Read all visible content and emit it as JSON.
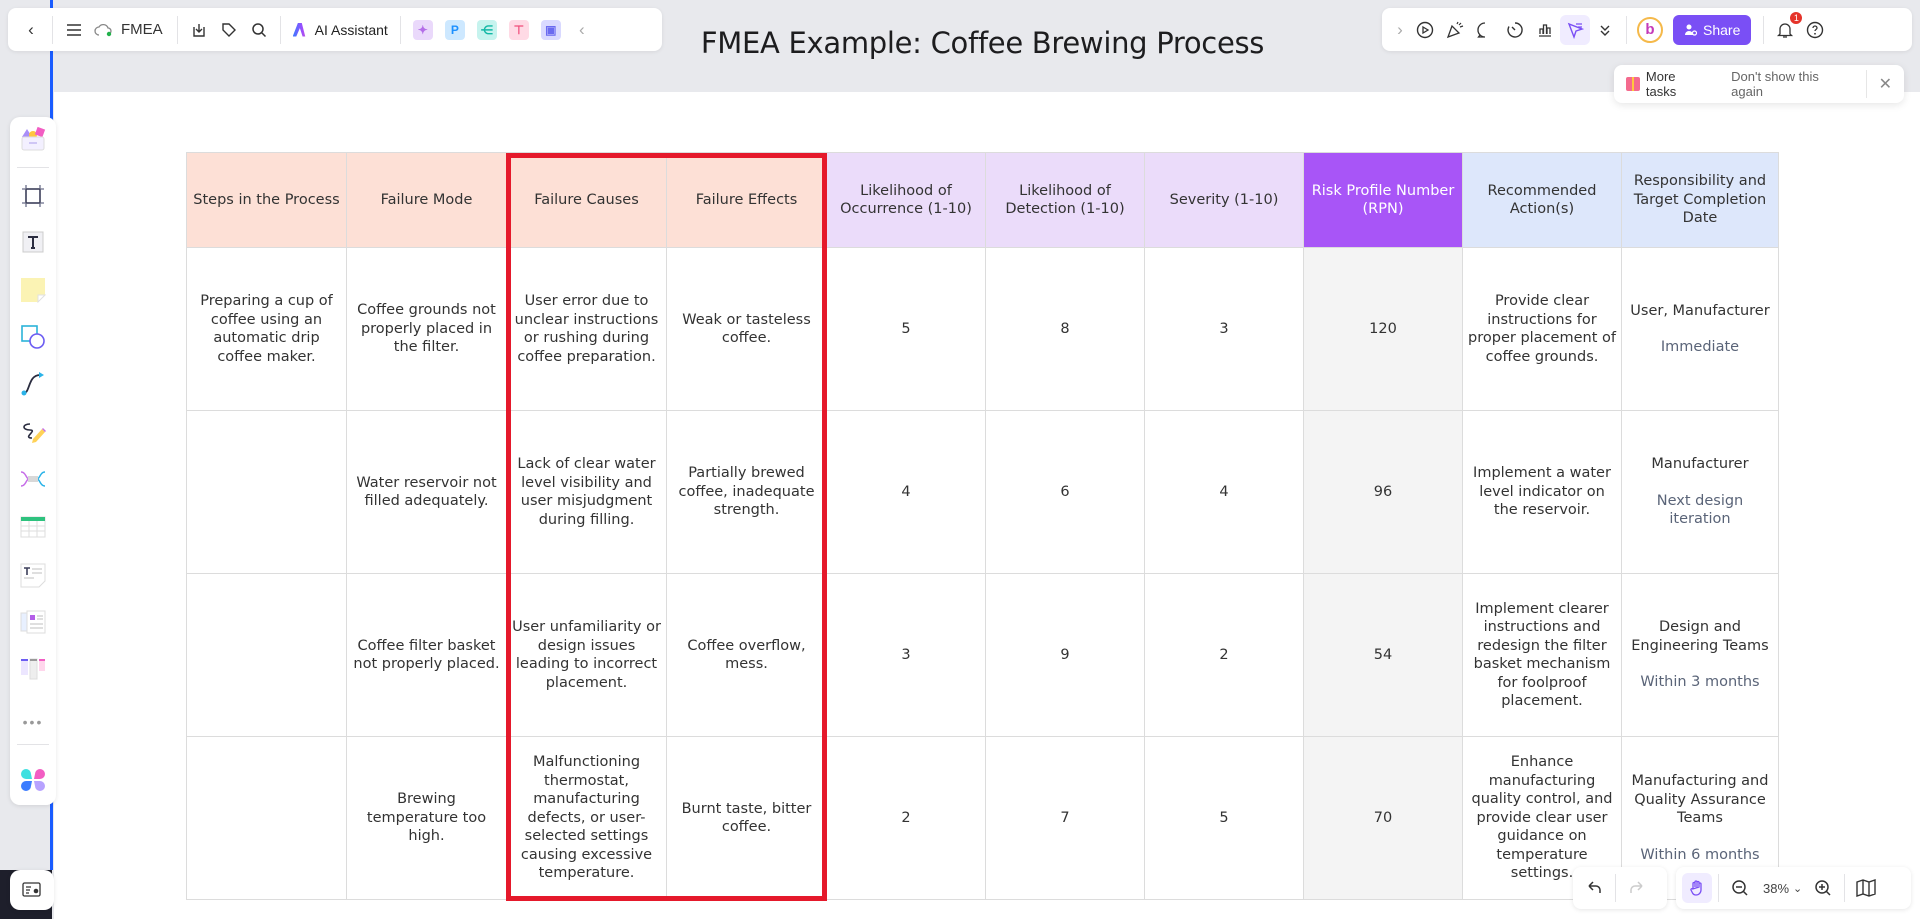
{
  "document": {
    "title": "FMEA Example: Coffee Brewing Process",
    "file_name": "FMEA"
  },
  "toolbar_left": {
    "back_icon": "chevron-left-icon",
    "menu_icon": "hamburger-menu-icon",
    "cloud_icon": "cloud-saved-icon",
    "file_name": "FMEA",
    "download_icon": "download-icon",
    "tag_icon": "tag-icon",
    "search_icon": "search-icon",
    "ai_assistant_label": "AI Assistant",
    "apps": [
      {
        "name": "image-gen-app",
        "color": "#e9d5ff",
        "glyph": "✦"
      },
      {
        "name": "presentation-app",
        "color": "#cfe8ff",
        "glyph": "P"
      },
      {
        "name": "mindmap-app",
        "color": "#c9f4ef",
        "glyph": "⋲"
      },
      {
        "name": "flowchart-app",
        "color": "#ffdbe6",
        "glyph": "⊤"
      },
      {
        "name": "chat-app",
        "color": "#dcdcff",
        "glyph": "▣"
      }
    ],
    "collapse_icon": "chevron-left-icon"
  },
  "toolbar_right": {
    "expand_icon": "chevron-right-icon",
    "tools": [
      "present-icon",
      "celebrate-icon",
      "comment-icon",
      "timer-icon",
      "vote-icon",
      "laser-pointer-icon",
      "more-tools-icon"
    ],
    "avatar_letter": "b",
    "share_label": "Share",
    "notification_count": "1",
    "help_icon": "help-icon"
  },
  "popup": {
    "more_tasks_label": "More tasks",
    "dont_show_label": "Don't show this again"
  },
  "palette": {
    "items": [
      "templates-icon",
      "frame-icon",
      "text-icon",
      "sticky-note-icon",
      "shape-icon",
      "connector-icon",
      "pen-icon",
      "mindmap-icon",
      "table-icon",
      "text-doc-icon",
      "card-icon",
      "kanban-icon",
      "more-icon",
      "apps-icon"
    ]
  },
  "table": {
    "headers": [
      "Steps in the Process",
      "Failure Mode",
      "Failure Causes",
      "Failure Effects",
      "Likelihood of Occurrence (1-10)",
      "Likelihood of Detection (1-10)",
      "Severity (1-10)",
      "Risk Profile Number (RPN)",
      "Recommended Action(s)",
      "Responsibility and Target Completion Date"
    ],
    "header_colors": {
      "peach": "#fde0d6",
      "lavender": "#ebdcfa",
      "purple": "#a855f7",
      "blue": "#dde7fb"
    },
    "rows": [
      {
        "step": "Preparing a cup of coffee using an automatic drip coffee maker.",
        "failure_mode": "Coffee grounds not properly placed in the filter.",
        "causes": "User error due to unclear instructions or rushing during coffee preparation.",
        "effects": "Weak or tasteless coffee.",
        "occurrence": "5",
        "detection": "8",
        "severity": "3",
        "rpn": "120",
        "action": "Provide clear instructions for proper placement of coffee grounds.",
        "responsibility": "User, Manufacturer",
        "target_date": "Immediate"
      },
      {
        "step": "",
        "failure_mode": "Water reservoir not filled adequately.",
        "causes": "Lack of clear water level visibility and user misjudgment during filling.",
        "effects": "Partially brewed coffee, inadequate strength.",
        "occurrence": "4",
        "detection": "6",
        "severity": "4",
        "rpn": "96",
        "action": "Implement a water level indicator on the reservoir.",
        "responsibility": "Manufacturer",
        "target_date": "Next design iteration"
      },
      {
        "step": "",
        "failure_mode": "Coffee filter basket not properly placed.",
        "causes": "User unfamiliarity or design issues leading to incorrect placement.",
        "effects": "Coffee overflow, mess.",
        "occurrence": "3",
        "detection": "9",
        "severity": "2",
        "rpn": "54",
        "action": "Implement clearer instructions and redesign the filter basket mechanism for foolproof placement.",
        "responsibility": "Design and Engineering Teams",
        "target_date": "Within 3 months"
      },
      {
        "step": "",
        "failure_mode": "Brewing temperature too high.",
        "causes": "Malfunctioning thermostat, manufacturing defects, or user-selected settings causing excessive temperature.",
        "effects": "Burnt taste, bitter coffee.",
        "occurrence": "2",
        "detection": "7",
        "severity": "5",
        "rpn": "70",
        "action": "Enhance manufacturing quality control, and provide clear user guidance on temperature settings.",
        "responsibility": "Manufacturing and Quality Assurance Teams",
        "target_date": "Within 6 months"
      }
    ],
    "highlight_color": "#e5192b"
  },
  "bottom_controls": {
    "undo_icon": "undo-icon",
    "redo_icon": "redo-icon",
    "hand_icon": "hand-tool-icon",
    "zoom_out_icon": "zoom-out-icon",
    "zoom_level": "38%",
    "zoom_in_icon": "zoom-in-icon",
    "map_icon": "minimap-icon"
  },
  "accent_color": "#7a4ff5"
}
